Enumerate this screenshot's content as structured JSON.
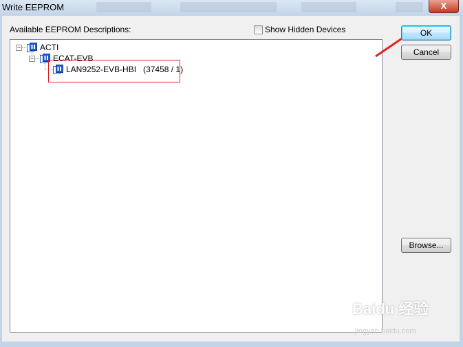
{
  "window": {
    "title": "Write EEPROM",
    "close_glyph": "X"
  },
  "label_available": "Available EEPROM Descriptions:",
  "show_hidden": {
    "label": "Show Hidden Devices",
    "checked": false
  },
  "tree": {
    "items": [
      {
        "label": "ACTI",
        "expander": "−"
      },
      {
        "label": "ECAT-EVB",
        "expander": "−"
      },
      {
        "label": "LAN9252-EVB-HBI",
        "suffix": "(37458 / 1)"
      }
    ]
  },
  "buttons": {
    "ok": "OK",
    "cancel": "Cancel",
    "browse": "Browse..."
  },
  "watermark": {
    "brand": "Baidu 经验",
    "url": "jingyan.baidu.com"
  },
  "colors": {
    "accent": "#3c7fb1",
    "highlight": "#e02020",
    "icon_blue": "#1e5bd6"
  }
}
